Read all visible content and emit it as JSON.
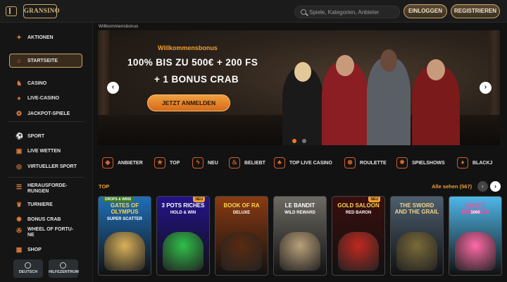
{
  "header": {
    "logo_text": "GRANSINO",
    "search_placeholder": "Spiele, Kategorien, Anbieter",
    "login_label": "EINLOGGEN",
    "register_label": "REGISTRIEREN"
  },
  "sidebar": {
    "items": [
      {
        "label": "AKTIONEN",
        "icon": "gift-icon"
      },
      {
        "label": "STARTSEITE",
        "icon": "home-icon"
      },
      {
        "label": "CASINO",
        "icon": "casino-icon"
      },
      {
        "label": "LIVE-CASINO",
        "icon": "live-casino-icon"
      },
      {
        "label": "JACKPOT-SPIELE",
        "icon": "jackpot-icon"
      },
      {
        "label": "SPORT",
        "icon": "soccer-ball-icon"
      },
      {
        "label": "LIVE WETTEN",
        "icon": "live-bet-icon"
      },
      {
        "label": "VIRTUELLER SPORT",
        "icon": "virtual-sport-icon"
      },
      {
        "label": "HERAUSFORDE-",
        "label2": "RUNGEN",
        "icon": "challenge-icon"
      },
      {
        "label": "TURNIERE",
        "icon": "trophy-icon"
      },
      {
        "label": "BONUS CRAB",
        "icon": "crab-icon"
      },
      {
        "label": "WHEEL OF FORTU-",
        "label2": "NE",
        "icon": "wheel-icon"
      },
      {
        "label": "SHOP",
        "icon": "shop-icon"
      }
    ],
    "lang_label": "DEUTSCH",
    "help_label": "HILFEZENTRUM"
  },
  "breadcrumb": "Willkommensbonus",
  "banner": {
    "kicker": "Willkommensbonus",
    "line1": "100% BIS ZU 500€ + 200 FS",
    "line2": "+ 1 BONUS CRAB",
    "cta": "JETZT ANMELDEN",
    "active_slide": 1,
    "slides": 2
  },
  "categories": [
    "ANBIETER",
    "TOP",
    "NEU",
    "BELIEBT",
    "TOP LIVE CASINO",
    "ROULETTE",
    "SPIELSHOWS",
    "BLACKJ"
  ],
  "section": {
    "title": "TOP",
    "see_all": "Alle sehen (567)"
  },
  "games": [
    {
      "title": "GATES OF OLYMPUS",
      "sub": "SUPER SCATTER",
      "tag": "DROPS & WINS",
      "badge": "",
      "bg": "#1f6fb8",
      "art": "#d9b15a",
      "color": "#ffd54a"
    },
    {
      "title": "3 POTS RICHES",
      "sub": "HOLD & WIN",
      "tag": "",
      "badge": "NEU",
      "bg": "#24138a",
      "art": "#2fbf4a",
      "color": "#ffffff"
    },
    {
      "title": "BOOK OF RA",
      "sub": "DELUXE",
      "tag": "",
      "badge": "",
      "bg": "#8a3a12",
      "art": "#5a2a10",
      "color": "#ffd54a"
    },
    {
      "title": "LE BANDIT",
      "sub": "WILD REWARD",
      "tag": "",
      "badge": "",
      "bg": "#6d6a62",
      "art": "#b9a07a",
      "color": "#ffffff"
    },
    {
      "title": "GOLD SALOON",
      "sub": "RED BARON",
      "tag": "",
      "badge": "NEU",
      "bg": "#3a0e0e",
      "art": "#c0281e",
      "color": "#ffd54a"
    },
    {
      "title": "THE SWORD AND THE GRAIL",
      "sub": "",
      "tag": "",
      "badge": "",
      "bg": "#4c5e6e",
      "art": "#7a6a3a",
      "color": "#f3d48a"
    },
    {
      "title": "SWEET BONANZA",
      "sub": "1000",
      "tag": "",
      "badge": "",
      "bg": "#4fb7e8",
      "art": "#ff6aa8",
      "color": "#ff4aa0"
    }
  ]
}
